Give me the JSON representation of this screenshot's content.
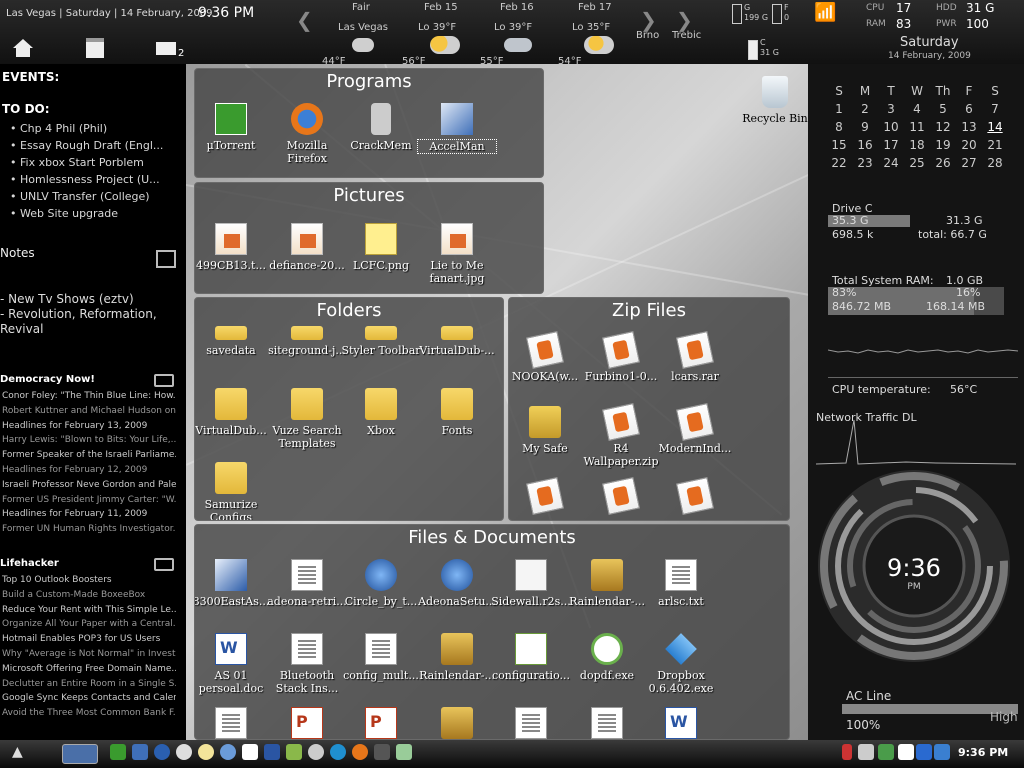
{
  "topbar": {
    "location_date": "Las Vegas | Saturday | 14 February, 2009",
    "time": "9.36 PM",
    "mail_count": "2",
    "weather": {
      "today_condition": "Fair",
      "today_city": "Las Vegas",
      "today_temp": "44°F",
      "days": [
        {
          "date": "Feb 15",
          "lo": "Lo 39°F",
          "hi": "56°F"
        },
        {
          "date": "Feb 16",
          "lo": "Lo 39°F",
          "hi": "55°F"
        },
        {
          "date": "Feb 17",
          "lo": "Lo 35°F",
          "hi": "54°F"
        }
      ],
      "city2": "Brno",
      "city3": "Trebic"
    },
    "drives": {
      "g_label": "G",
      "g_size": "199 G",
      "f_label": "F",
      "f_size": "0",
      "c_label": "C",
      "c_size": "31 G"
    },
    "stats": {
      "cpu_label": "CPU",
      "cpu_val": "17",
      "hdd_label": "HDD",
      "hdd_val": "31 G",
      "ram_label": "RAM",
      "ram_val": "83",
      "pwr_label": "PWR",
      "pwr_val": "100"
    },
    "day_name": "Saturday",
    "full_date": "14 February, 2009"
  },
  "left": {
    "events_label": "EVENTS:",
    "todo_label": "TO DO:",
    "todos": [
      "Chp 4 Phil (Phil)",
      "Essay Rough Draft (Engl...",
      "Fix xbox Start Porblem",
      "Homlessness Project (U...",
      "UNLV Transfer (College)",
      "Web Site upgrade"
    ],
    "notes_label": "Notes",
    "notes": [
      "- New Tv Shows (eztv)",
      "- Revolution, Reformation,",
      "Revival"
    ],
    "feed1_title": "Democracy Now!",
    "feed1_items": [
      "Conor Foley: \"The Thin Blue Line: How...",
      "Robert Kuttner and Michael Hudson on...",
      "Headlines for February 13, 2009",
      "Harry Lewis: \"Blown to Bits: Your Life,...",
      "Former Speaker of the Israeli Parliame...",
      "Headlines for February 12, 2009",
      "Israeli Professor Neve Gordon and Pale...",
      "Former US President Jimmy Carter: \"W...",
      "Headlines for February 11, 2009",
      "Former UN Human Rights Investigator..."
    ],
    "feed2_title": "Lifehacker",
    "feed2_items": [
      "Top 10 Outlook Boosters",
      "Build a Custom-Made BoxeeBox",
      "Reduce Your Rent with This Simple Le...",
      "Organize All Your Paper with a Central...",
      "Hotmail Enables POP3 for US Users",
      "Why \"Average is Not Normal\" in Investi...",
      "Microsoft Offering Free Domain Name...",
      "Declutter an Entire Room in a Single S...",
      "Google Sync Keeps Contacts and Calen...",
      "Avoid the Three Most Common Bank F..."
    ]
  },
  "panels": {
    "programs_title": "Programs",
    "programs": [
      "µTorrent",
      "Mozilla Firefox",
      "CrackMem",
      "AccelMan"
    ],
    "pictures_title": "Pictures",
    "pictures": [
      "499CB13.t...",
      "defiance-20...",
      "LCFC.png",
      "Lie to Me fanart.jpg"
    ],
    "folders_title": "Folders",
    "folders": [
      "savedata",
      "siteground-j...",
      "Styler Toolbar",
      "VirtualDub-...",
      "VirtualDub...",
      "Vuze Search Templates",
      "Xbox",
      "Fonts",
      "Samurize Configs"
    ],
    "zip_title": "Zip Files",
    "zips": [
      "NOOKA(w...",
      "Furbino1-0...",
      "lcars.rar",
      "My Safe",
      "R4 Wallpaper.zip",
      "ModernInd..."
    ],
    "files_title": "Files & Documents",
    "files": [
      "8300EastAs...",
      "adeona-retri...",
      "Circle_by_t...",
      "AdeonaSetu...",
      "Sidewall.r2s...",
      "Rainlendar-...",
      "arlsc.txt",
      "AS 01 persoal.doc",
      "Bluetooth Stack Ins...",
      "config_mult...",
      "Rainlendar-...",
      "configuratio...",
      "dopdf.exe",
      "Dropbox 0.6.402.exe"
    ],
    "recycle": "Recycle Bin"
  },
  "right": {
    "cal_head": [
      "S",
      "M",
      "T",
      "W",
      "Th",
      "F",
      "S"
    ],
    "cal_rows": [
      [
        "1",
        "2",
        "3",
        "4",
        "5",
        "6",
        "7"
      ],
      [
        "8",
        "9",
        "10",
        "11",
        "12",
        "13",
        "14"
      ],
      [
        "15",
        "16",
        "17",
        "18",
        "19",
        "20",
        "21"
      ],
      [
        "22",
        "23",
        "24",
        "25",
        "26",
        "27",
        "28"
      ]
    ],
    "drive_label": "Drive C",
    "drive_used": "35.3 G",
    "drive_free": "31.3 G",
    "drive_k": "698.5 k",
    "drive_total": "total: 66.7 G",
    "ram_label": "Total System RAM:",
    "ram_total": "1.0 GB",
    "ram_pct_used": "83%",
    "ram_pct_free": "16%",
    "ram_used": "846.72 MB",
    "ram_free": "168.14 MB",
    "cpu_temp_label": "CPU temperature:",
    "cpu_temp": "56°C",
    "net_label": "Network Traffic DL",
    "clock_time": "9:36",
    "clock_ampm": "PM",
    "power_label": "AC Line",
    "power_pct": "100%",
    "power_high": "High"
  },
  "taskbar": {
    "clock": "9:36 PM"
  }
}
